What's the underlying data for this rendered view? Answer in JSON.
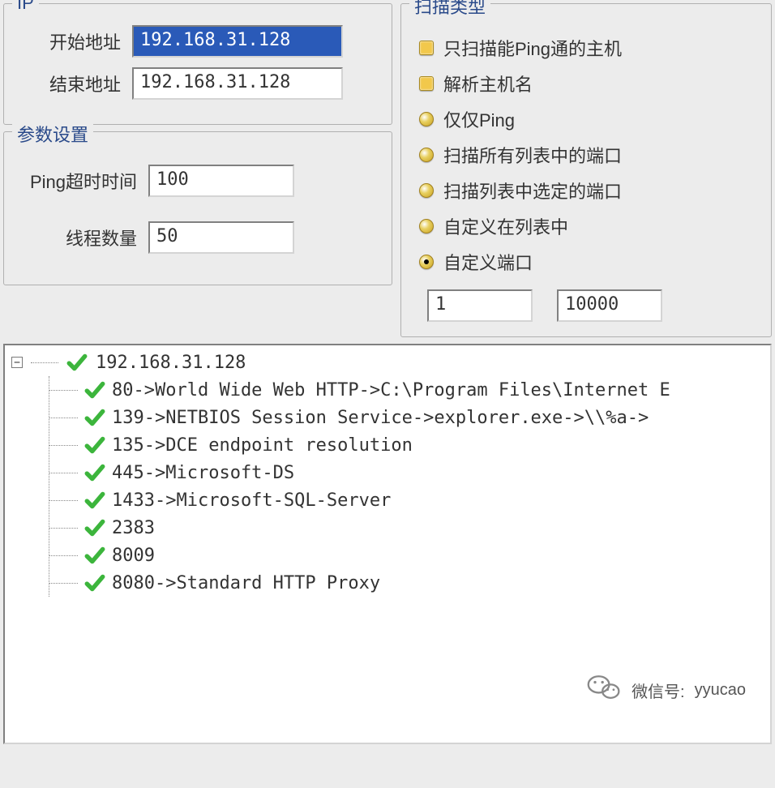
{
  "ip": {
    "legend": "IP",
    "startLabel": "开始地址",
    "startValue": "192.168.31.128",
    "endLabel": "结束地址",
    "endValue": "192.168.31.128"
  },
  "params": {
    "legend": "参数设置",
    "pingTimeoutLabel": "Ping超时时间",
    "pingTimeoutValue": "100",
    "threadsLabel": "线程数量",
    "threadsValue": "50"
  },
  "scan": {
    "legend": "扫描类型",
    "check1": "只扫描能Ping通的主机",
    "check2": "解析主机名",
    "radio1": "仅仅Ping",
    "radio2": "扫描所有列表中的端口",
    "radio3": "扫描列表中选定的端口",
    "radio4": "自定义在列表中",
    "radio5": "自定义端口",
    "radioSelected": 5,
    "portStart": "1",
    "portEnd": "10000"
  },
  "tree": {
    "root": "192.168.31.128",
    "items": [
      "80->World Wide Web HTTP->C:\\Program Files\\Internet E",
      "139->NETBIOS Session Service->explorer.exe->\\\\%a->",
      "135->DCE endpoint resolution",
      "445->Microsoft-DS",
      "1433->Microsoft-SQL-Server",
      "2383",
      "8009",
      "8080->Standard HTTP Proxy"
    ]
  },
  "watermark": {
    "label": "微信号:",
    "id": "yyucao"
  }
}
